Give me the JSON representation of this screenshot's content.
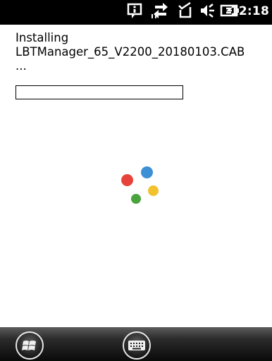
{
  "status_bar": {
    "time": "12:18",
    "icons": [
      "notification-icon",
      "data-sync-icon",
      "signal-off-icon",
      "volume-icon",
      "battery-charging-icon"
    ]
  },
  "install": {
    "line1": "Installing",
    "line2": "LBTManager_65_V2200_20180103.CAB",
    "line3": "...",
    "progress": 0
  },
  "spinner": {
    "colors": [
      "#e8433a",
      "#3d8fd6",
      "#f2c12e",
      "#4aa33d"
    ]
  },
  "taskbar": {
    "start_icon": "windows-logo-icon",
    "keyboard_icon": "keyboard-icon"
  }
}
